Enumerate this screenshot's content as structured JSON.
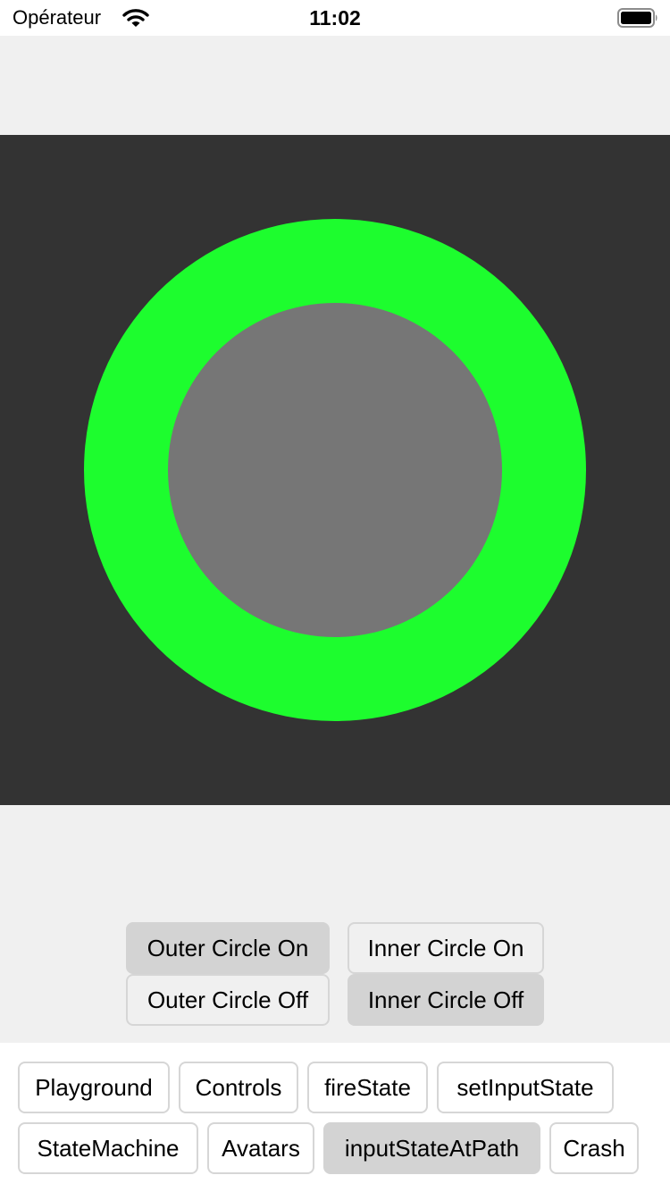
{
  "status_bar": {
    "carrier": "Opérateur",
    "time": "11:02",
    "wifi_icon": "wifi-icon",
    "battery_icon": "battery-full-icon"
  },
  "canvas": {
    "background_color": "#333333",
    "outer_circle_color": "#1dfd2e",
    "inner_circle_color": "#767676"
  },
  "controls": {
    "outer_on": "Outer Circle On",
    "outer_off": "Outer Circle Off",
    "inner_on": "Inner Circle On",
    "inner_off": "Inner Circle Off",
    "selected": [
      "Outer Circle On",
      "Inner Circle Off"
    ]
  },
  "tabs": {
    "items": [
      {
        "label": "Playground"
      },
      {
        "label": "Controls"
      },
      {
        "label": "fireState"
      },
      {
        "label": "setInputState"
      },
      {
        "label": "StateMachine"
      },
      {
        "label": "Avatars"
      },
      {
        "label": "inputStateAtPath"
      },
      {
        "label": "Crash"
      }
    ],
    "selected": "inputStateAtPath"
  },
  "colors": {
    "selected_button": "#d3d3d3",
    "button_border": "#d6d6d6",
    "content_background": "#f0f0f0"
  }
}
